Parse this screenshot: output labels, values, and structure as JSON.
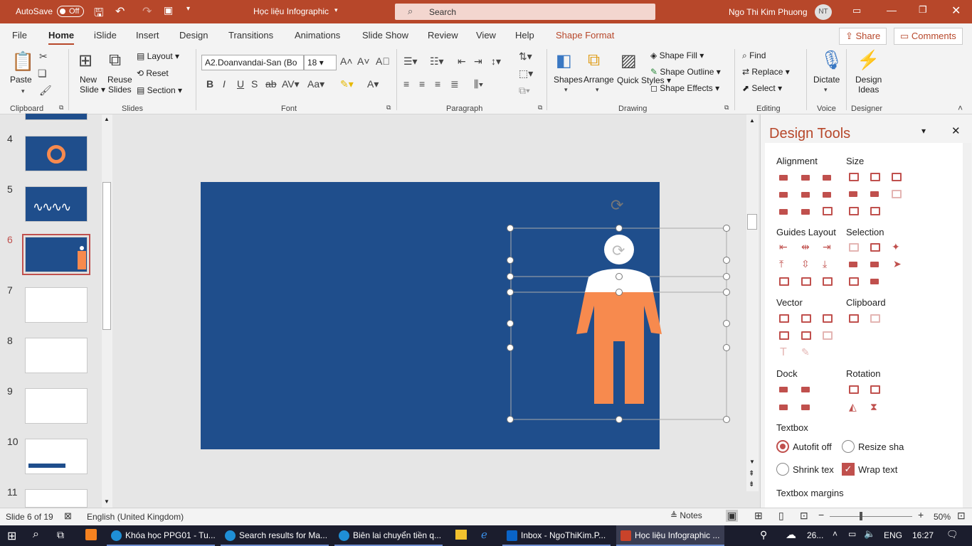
{
  "titlebar": {
    "autosave_label": "AutoSave",
    "autosave_state": "Off",
    "doc_title": "Học liệu Infographic",
    "search_placeholder": "Search",
    "user_name": "Ngo Thi Kim Phuong",
    "user_initials": "NT"
  },
  "tabs": [
    "File",
    "Home",
    "iSlide",
    "Insert",
    "Design",
    "Transitions",
    "Animations",
    "Slide Show",
    "Review",
    "View",
    "Help",
    "Shape Format"
  ],
  "active_tab": "Home",
  "share_label": "Share",
  "comments_label": "Comments",
  "ribbon": {
    "clipboard": {
      "paste": "Paste",
      "group": "Clipboard"
    },
    "slides": {
      "new_slide": "New Slide",
      "reuse_slides": "Reuse Slides",
      "layout": "Layout",
      "reset": "Reset",
      "section": "Section",
      "group": "Slides"
    },
    "font": {
      "font_name": "A2.Doanvandai-San (Bo",
      "font_size": "18",
      "group": "Font"
    },
    "paragraph": {
      "group": "Paragraph"
    },
    "drawing": {
      "shapes": "Shapes",
      "arrange": "Arrange",
      "quick_styles": "Quick Styles",
      "shape_fill": "Shape Fill",
      "shape_outline": "Shape Outline",
      "shape_effects": "Shape Effects",
      "group": "Drawing"
    },
    "editing": {
      "find": "Find",
      "replace": "Replace",
      "select": "Select",
      "group": "Editing"
    },
    "voice": {
      "dictate": "Dictate",
      "group": "Voice"
    },
    "designer": {
      "design_ideas": "Design Ideas",
      "group": "Designer"
    }
  },
  "thumbnails": [
    "4",
    "5",
    "6",
    "7",
    "8",
    "9",
    "10",
    "11"
  ],
  "selected_slide": "6",
  "design_tools": {
    "title": "Design Tools",
    "sections": {
      "alignment": "Alignment",
      "size": "Size",
      "guides_layout": "Guides Layout",
      "selection": "Selection",
      "vector": "Vector",
      "clipboard": "Clipboard",
      "dock": "Dock",
      "rotation": "Rotation",
      "textbox": "Textbox",
      "textbox_margins": "Textbox margins"
    },
    "options": {
      "autofit_off": "Autofit off",
      "resize_shape": "Resize sha",
      "shrink_text": "Shrink tex",
      "wrap_text": "Wrap text"
    }
  },
  "status": {
    "slide_info": "Slide 6 of 19",
    "language": "English (United Kingdom)",
    "notes": "Notes",
    "zoom": "50%"
  },
  "taskbar": {
    "items": [
      "Khóa học PPG01 - Tu...",
      "Search results for Ma...",
      "Biên lai chuyển tiền q...",
      "Inbox - NgoThiKim.P...",
      "Học liệu Infographic ..."
    ],
    "weather": "26...",
    "lang": "ENG",
    "time": "16:27"
  },
  "colors": {
    "accent": "#b7472a",
    "slide_bg": "#1f4e8c",
    "figure": "#f78a4e",
    "tool_icon": "#c0504d"
  }
}
